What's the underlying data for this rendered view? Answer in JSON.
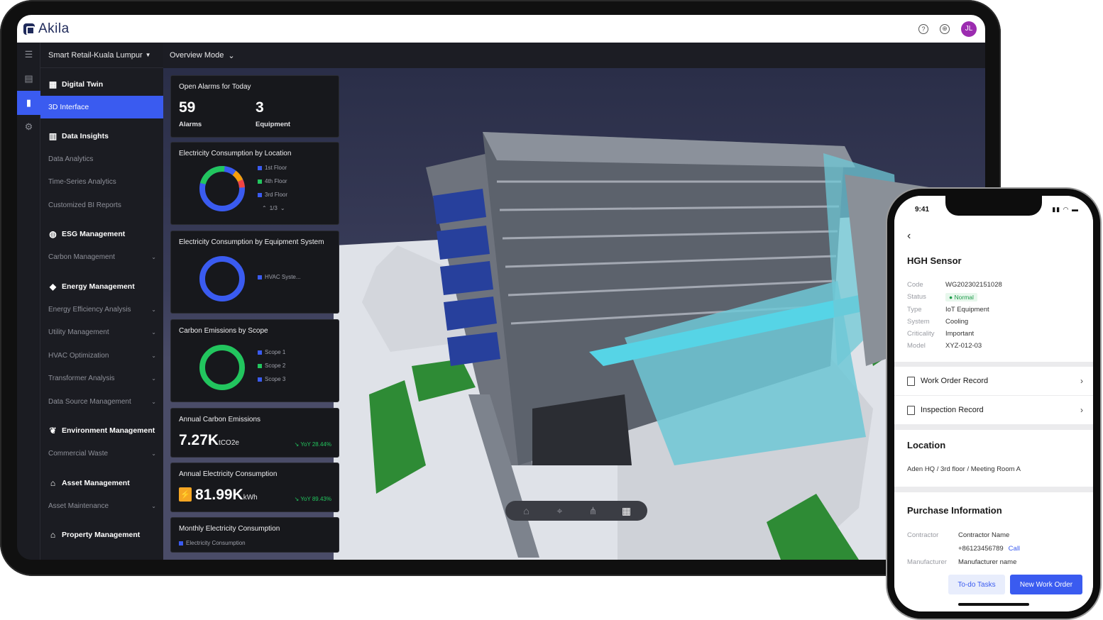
{
  "app": {
    "logo_text": "Akila",
    "help_icon": "help-circle-icon",
    "globe_icon": "globe-icon",
    "user_initials": "JL",
    "brand_color": "#3a5bf0"
  },
  "sidebar": {
    "site": "Smart Retail-Kuala Lumpur",
    "digital_twin": "Digital Twin",
    "interface_3d": "3D Interface",
    "data_insights": "Data Insights",
    "data_analytics": "Data Analytics",
    "time_series": "Time-Series Analytics",
    "bi_reports": "Customized BI Reports",
    "esg": "ESG Management",
    "carbon": "Carbon Management",
    "energy": "Energy Management",
    "energy_eff": "Energy Efficiency Analysis",
    "utility": "Utility Management",
    "hvac": "HVAC Optimization",
    "transformer": "Transformer Analysis",
    "data_source": "Data Source Management",
    "environment": "Environment Management",
    "commercial_waste": "Commercial Waste",
    "asset": "Asset Management",
    "asset_maint": "Asset Maintenance",
    "property": "Property Management"
  },
  "mode_bar": {
    "label": "Overview Mode"
  },
  "cards": {
    "alarms": {
      "title": "Open Alarms for Today",
      "alarms_value": "59",
      "alarms_label": "Alarms",
      "equip_value": "3",
      "equip_label": "Equipment"
    },
    "by_location": {
      "title": "Electricity Consumption by Location",
      "legend": [
        "1st Floor",
        "4th Floor",
        "3rd Floor"
      ],
      "pager": "1/3"
    },
    "by_system": {
      "title": "Electricity Consumption by Equipment System",
      "legend": [
        "HVAC Syste..."
      ]
    },
    "scope": {
      "title": "Carbon Emissions by Scope",
      "legend": [
        "Scope 1",
        "Scope 2",
        "Scope 3"
      ]
    },
    "annual_carbon": {
      "title": "Annual Carbon Emissions",
      "value": "7.27K",
      "unit": "tCO2e",
      "yoy": "YoY 28.44%"
    },
    "annual_elec": {
      "title": "Annual Electricity Consumption",
      "value": "81.99K",
      "unit": "kWh",
      "yoy": "YoY 89.43%"
    },
    "monthly": {
      "title": "Monthly Electricity Consumption",
      "legend": "Electricity Consumption"
    }
  },
  "phone": {
    "time": "9:41",
    "title": "HGH Sensor",
    "fields": {
      "code_k": "Code",
      "code_v": "WG202302151028",
      "status_k": "Status",
      "status_v": "Normal",
      "type_k": "Type",
      "type_v": "IoT Equipment",
      "system_k": "System",
      "system_v": "Cooling",
      "crit_k": "Criticality",
      "crit_v": "Important",
      "model_k": "Model",
      "model_v": "XYZ-012-03"
    },
    "work_order": "Work Order Record",
    "inspection": "Inspection Record",
    "location_title": "Location",
    "location_path": "Aden HQ / 3rd floor / Meeting Room A",
    "purchase_title": "Purchase Information",
    "contractor_k": "Contractor",
    "contractor_v": "Contractor Name",
    "phone_v": "+86123456789",
    "call": "Call",
    "manufacturer_k": "Manufacturer",
    "manufacturer_v": "Manufacturer name",
    "todo": "To-do Tasks",
    "new_order": "New Work Order"
  }
}
